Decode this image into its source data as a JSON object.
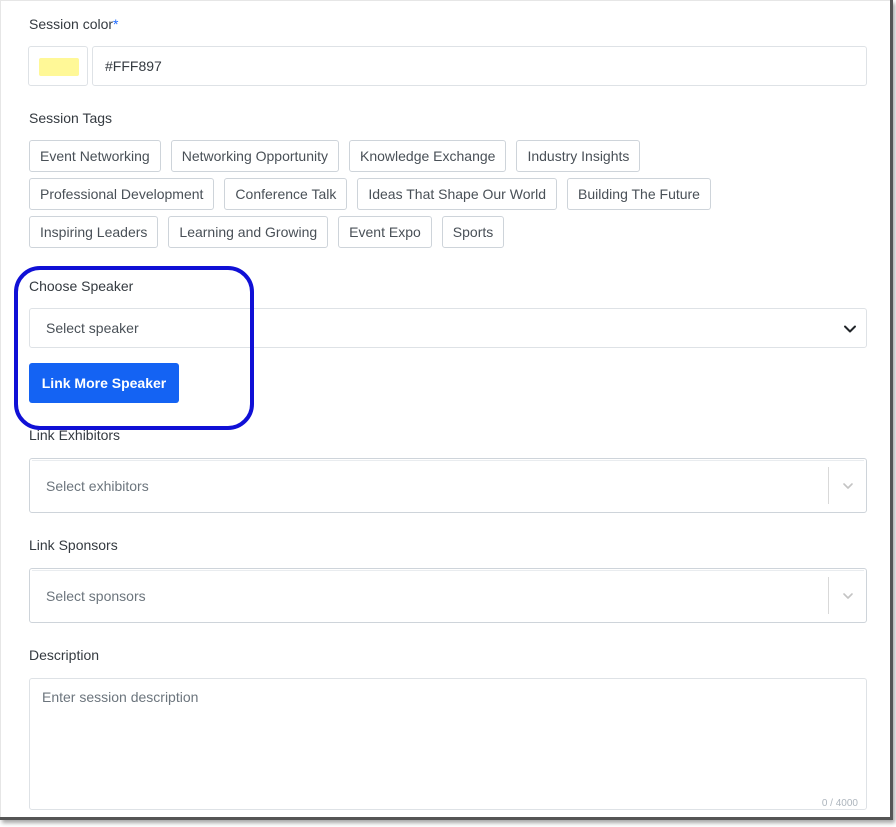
{
  "session_color": {
    "label": "Session color",
    "required_mark": "*",
    "value": "#FFF897",
    "swatch_color": "#FFF897"
  },
  "session_tags": {
    "label": "Session Tags",
    "rows": [
      [
        "Event Networking",
        "Networking Opportunity",
        "Knowledge Exchange",
        "Industry Insights"
      ],
      [
        "Professional Development",
        "Conference Talk",
        "Ideas That Shape Our World",
        "Building The Future"
      ],
      [
        "Inspiring Leaders",
        "Learning and Growing",
        "Event Expo",
        "Sports"
      ]
    ]
  },
  "speaker": {
    "label": "Choose Speaker",
    "selected": "Select speaker",
    "link_button": "Link More Speaker"
  },
  "exhibitors": {
    "label": "Link Exhibitors",
    "placeholder": "Select exhibitors"
  },
  "sponsors": {
    "label": "Link Sponsors",
    "placeholder": "Select sponsors"
  },
  "description": {
    "label": "Description",
    "placeholder": "Enter session description",
    "counter": "0 / 4000"
  },
  "colors": {
    "accent": "#1463F3",
    "highlight": "#1010D6"
  }
}
